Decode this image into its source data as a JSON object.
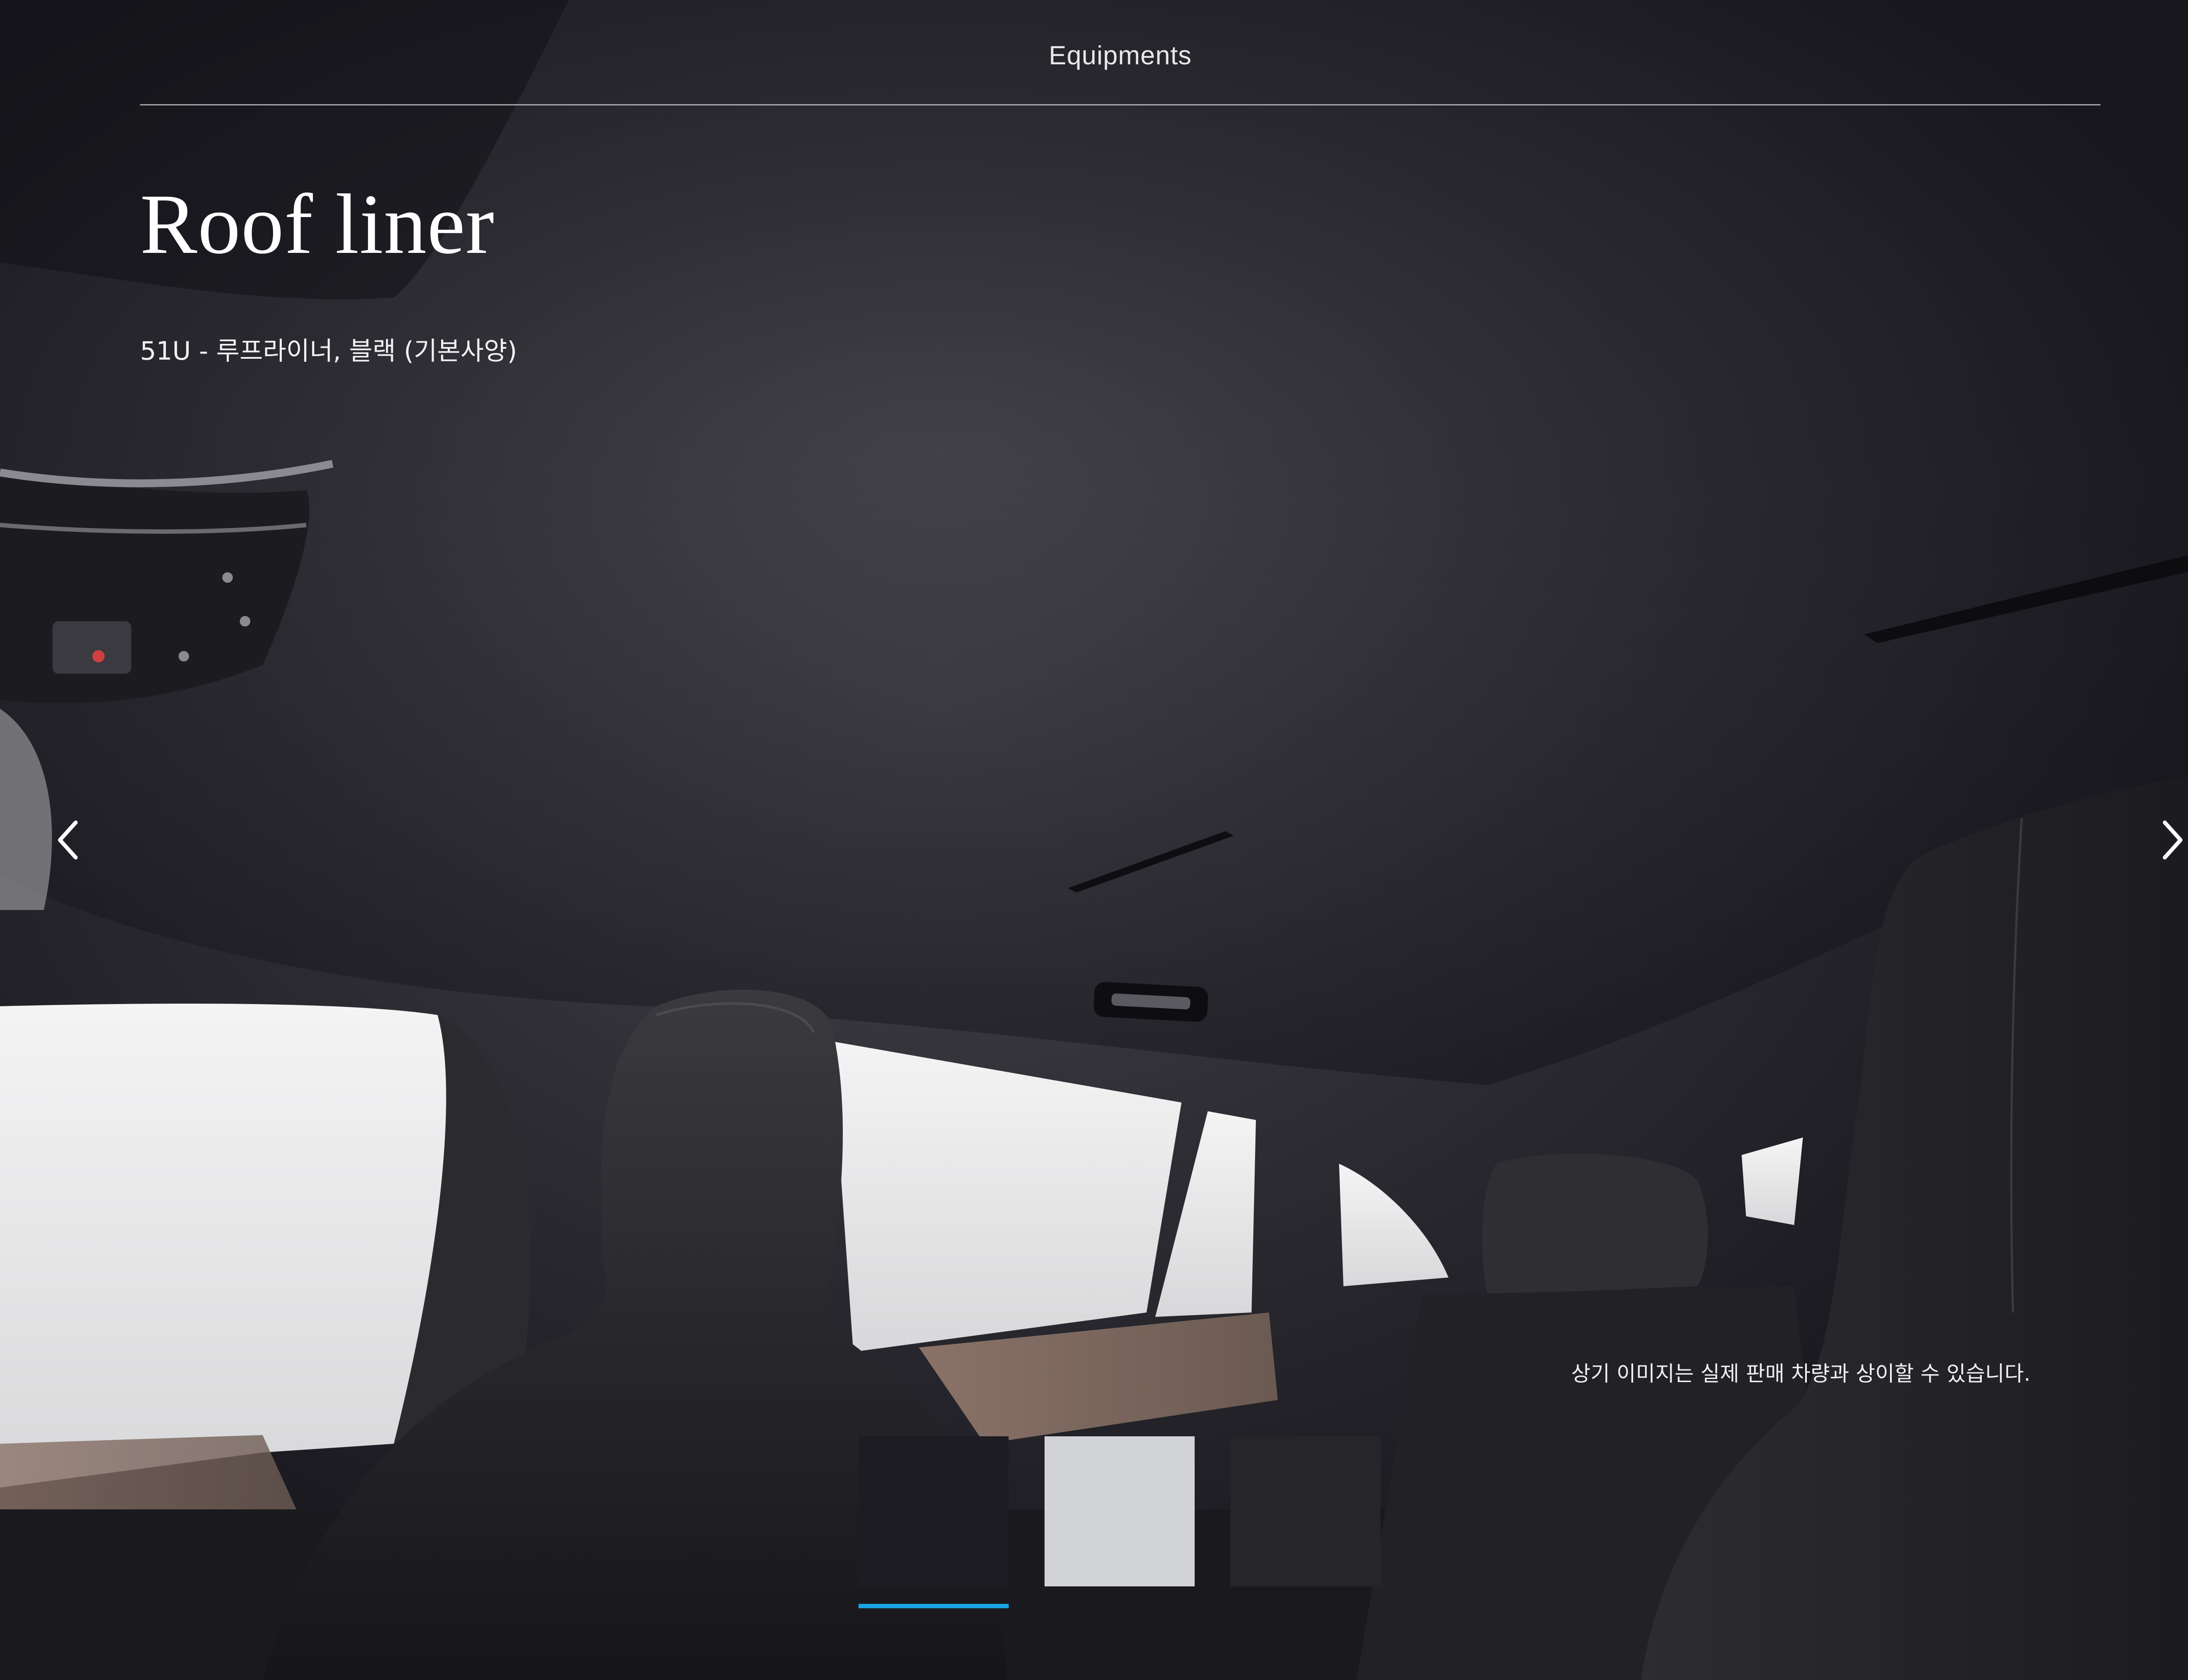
{
  "header": {
    "title": "Equipments"
  },
  "page": {
    "title": "Roof liner",
    "subtitle": "51U - 루프라이너, 블랙 (기본사양)",
    "disclaimer": "상기 이미지는 실제 판매 차량과 상이할 수 있습니다."
  },
  "navigation": {
    "prev_icon": "chevron-left-icon",
    "next_icon": "chevron-right-icon"
  },
  "swatches": [
    {
      "name": "black",
      "color": "#1c1c22",
      "selected": true
    },
    {
      "name": "light-grey",
      "color": "#d2d3d7",
      "selected": false
    },
    {
      "name": "dark-grey",
      "color": "#26262a",
      "selected": false
    }
  ],
  "colors": {
    "accent": "#19a3e6",
    "text": "#ffffff"
  }
}
